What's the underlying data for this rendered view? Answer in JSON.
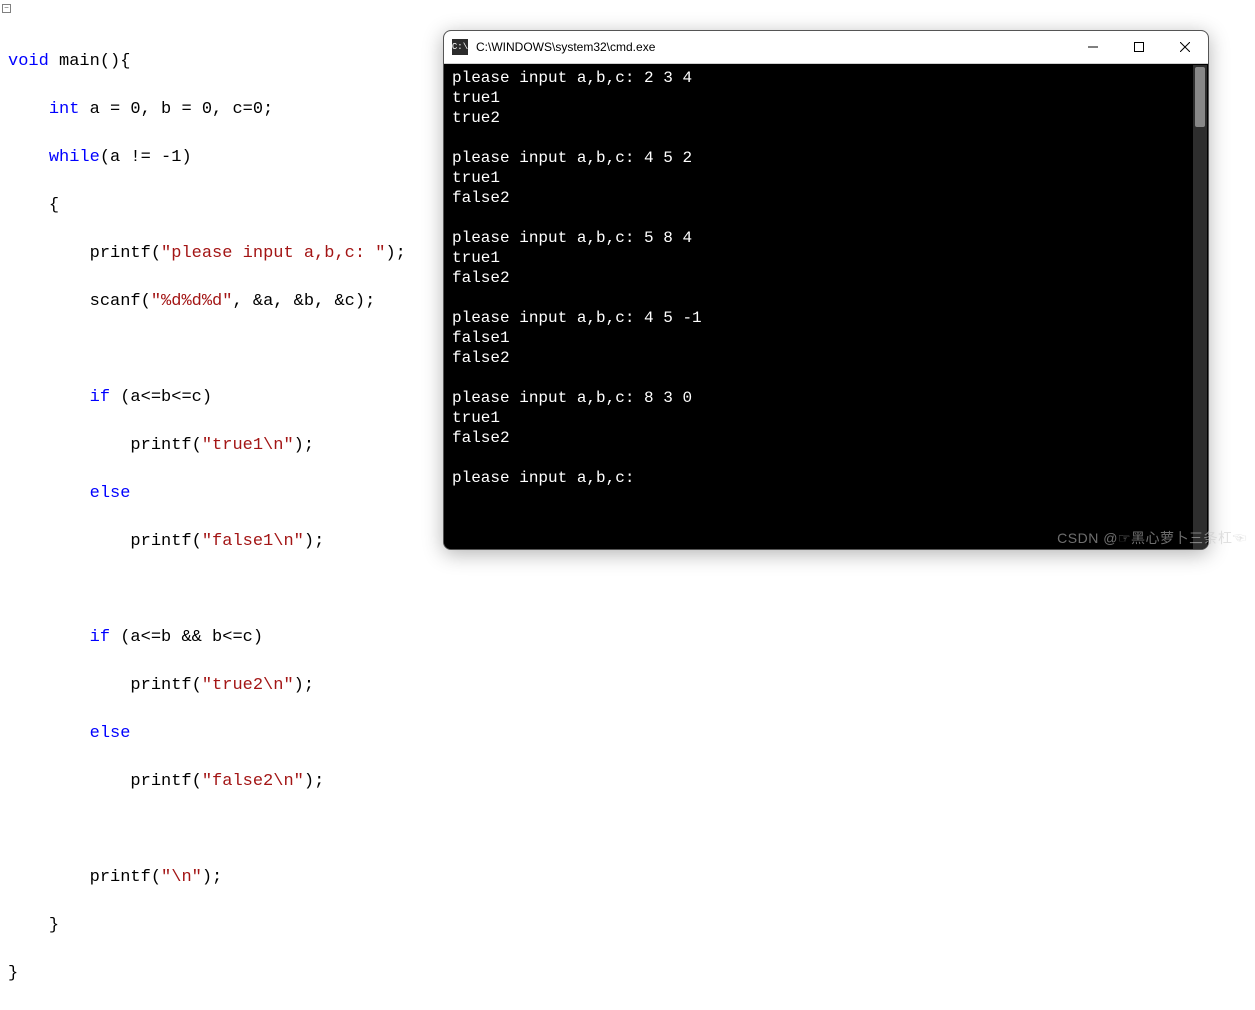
{
  "code": {
    "kw_void": "void",
    "fn": "main",
    "paren": "(){",
    "kw_int": "int",
    "decl": " a = 0, b = 0, c=0;",
    "kw_while": "while",
    "while_cond": "(a != -1)",
    "lbrace": "{",
    "rbrace": "}",
    "fn_printf": "printf",
    "fn_scanf": "scanf",
    "s_prompt": "\"please input a,b,c: \"",
    "s_scan": "\"%d%d%d\"",
    "scan_args": ", &a, &b, &c);",
    "kw_if": "if",
    "cond1": " (a<=b<=c)",
    "cond2": " (a<=b && b<=c)",
    "s_true1": "\"true1\\n\"",
    "s_false1": "\"false1\\n\"",
    "s_true2": "\"true2\\n\"",
    "s_false2": "\"false2\\n\"",
    "s_nl": "\"\\n\"",
    "kw_else": "else",
    "semi": ");",
    "close_paren": ");",
    "final_brace": "}"
  },
  "cmd": {
    "icon_label": "C:\\",
    "title": "C:\\WINDOWS\\system32\\cmd.exe",
    "output": "please input a,b,c: 2 3 4\ntrue1\ntrue2\n\nplease input a,b,c: 4 5 2\ntrue1\nfalse2\n\nplease input a,b,c: 5 8 4\ntrue1\nfalse2\n\nplease input a,b,c: 4 5 -1\nfalse1\nfalse2\n\nplease input a,b,c: 8 3 0\ntrue1\nfalse2\n\nplease input a,b,c:"
  },
  "watermark": "CSDN @☞黑心萝卜三条杠☜"
}
